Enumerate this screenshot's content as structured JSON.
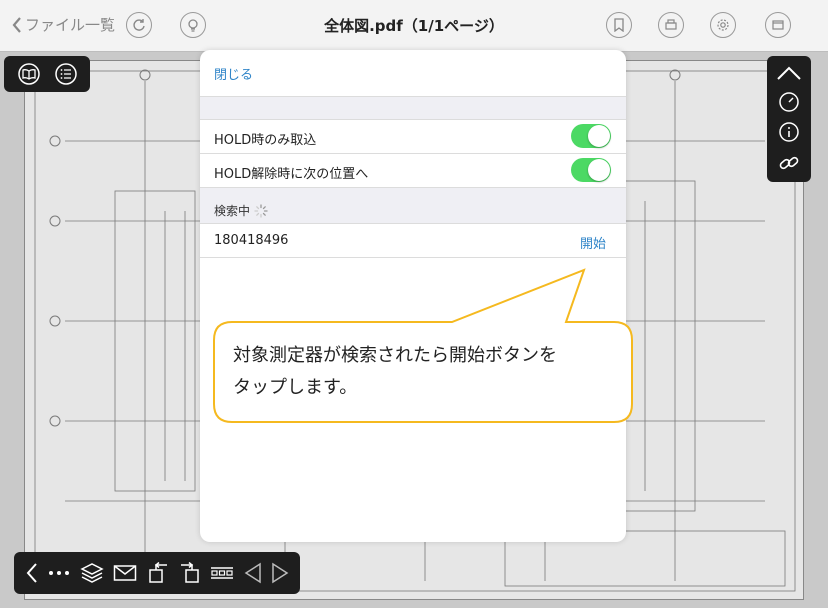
{
  "nav": {
    "back_label": "ファイル一覧",
    "title": "全体図.pdf（1/1ページ）"
  },
  "modal": {
    "close_label": "閉じる",
    "settings": [
      {
        "label": "HOLD時のみ取込",
        "on": true
      },
      {
        "label": "HOLD解除時に次の位置へ",
        "on": true
      }
    ],
    "searching_label": "検索中",
    "device_id": "180418496",
    "start_label": "開始"
  },
  "callout": {
    "line1": "対象測定器が検索されたら開始ボタンを",
    "line2": "タップします。"
  },
  "colors": {
    "accent": "#2e84c8",
    "toggle_on": "#4cd964",
    "callout_border": "#f5b91f"
  }
}
